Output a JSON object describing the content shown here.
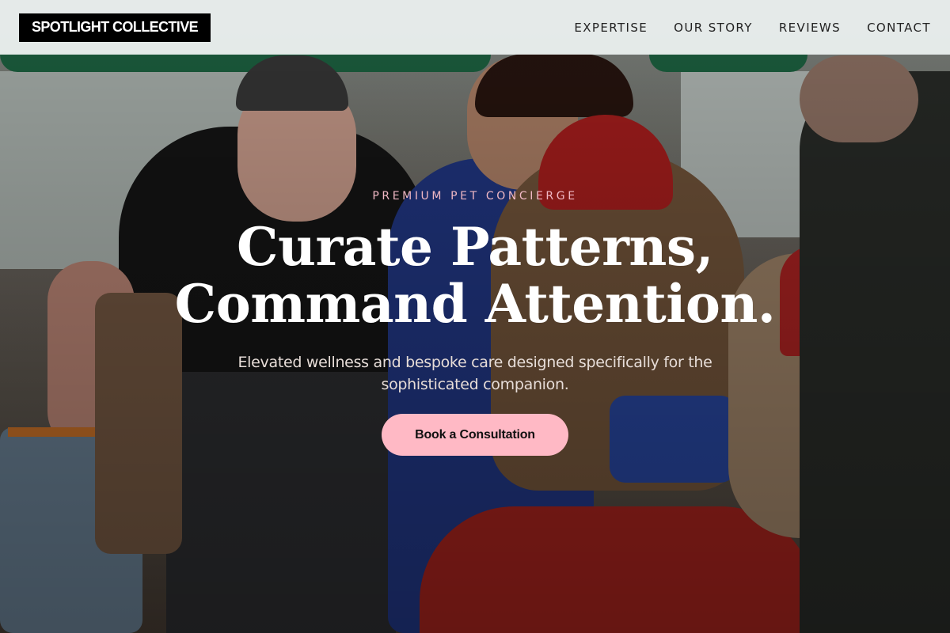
{
  "header": {
    "logo": "SPOTLIGHT COLLECTIVE",
    "nav": [
      "EXPERTISE",
      "OUR STORY",
      "REVIEWS",
      "CONTACT"
    ]
  },
  "hero": {
    "eyebrow": "PREMIUM PET CONCIERGE",
    "headline_line1": "Curate Patterns,",
    "headline_line2": "Command Attention.",
    "subtitle_line1": "Elevated wellness and bespoke care designed specifically for the",
    "subtitle_line2": "sophisticated companion.",
    "cta_label": "Book a Consultation"
  },
  "colors": {
    "accent": "#ffb9c5",
    "eyebrow": "#f0b8c4",
    "logo_bg": "#000000",
    "header_bg": "#ecf1f0"
  }
}
